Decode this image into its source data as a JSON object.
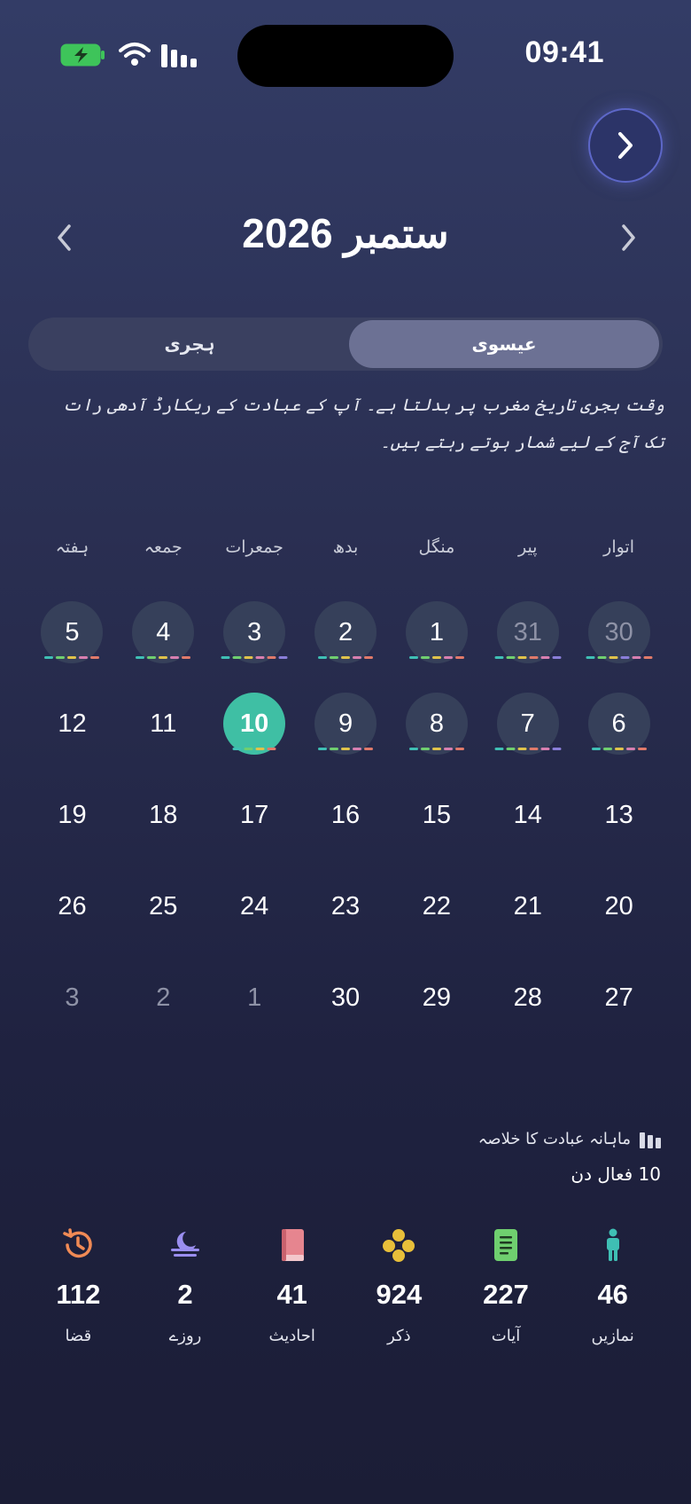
{
  "status_bar": {
    "time": "09:41"
  },
  "header": {
    "month_title": "ستمبر 2026"
  },
  "tabs": [
    {
      "label": "عیسوی",
      "active": true
    },
    {
      "label": "ہجری",
      "active": false
    }
  ],
  "note": "وقت ہجری تاریخ مغرب پر بدلتا ہے۔ آپ کے عبادت کے ریکارڈ آدھی رات تک آج کے لیے شمار ہوتے رہتے ہیں۔",
  "weekdays": [
    "اتوار",
    "پیر",
    "منگل",
    "بدھ",
    "جمعرات",
    "جمعہ",
    "ہفتہ"
  ],
  "days": [
    {
      "label": "30",
      "muted": true,
      "circle": true,
      "dots": [
        "#e07a6a",
        "#d77fb0",
        "#8a7ed8",
        "#e0c34a",
        "#6fcf6f",
        "#3fbfb4"
      ]
    },
    {
      "label": "31",
      "muted": true,
      "circle": true,
      "dots": [
        "#8a7ed8",
        "#d77fb0",
        "#e07a6a",
        "#e0c34a",
        "#6fcf6f",
        "#3fbfb4"
      ]
    },
    {
      "label": "1",
      "circle": true,
      "dots": [
        "#e07a6a",
        "#d77fb0",
        "#e0c34a",
        "#6fcf6f",
        "#3fbfb4"
      ]
    },
    {
      "label": "2",
      "circle": true,
      "dots": [
        "#e07a6a",
        "#d77fb0",
        "#e0c34a",
        "#6fcf6f",
        "#3fbfb4"
      ]
    },
    {
      "label": "3",
      "circle": true,
      "dots": [
        "#8a7ed8",
        "#e07a6a",
        "#d77fb0",
        "#e0c34a",
        "#6fcf6f",
        "#3fbfb4"
      ]
    },
    {
      "label": "4",
      "circle": true,
      "dots": [
        "#e07a6a",
        "#d77fb0",
        "#e0c34a",
        "#6fcf6f",
        "#3fbfb4"
      ]
    },
    {
      "label": "5",
      "circle": true,
      "dots": [
        "#e07a6a",
        "#d77fb0",
        "#e0c34a",
        "#6fcf6f",
        "#3fbfb4"
      ]
    },
    {
      "label": "6",
      "circle": true,
      "dots": [
        "#e07a6a",
        "#d77fb0",
        "#e0c34a",
        "#6fcf6f",
        "#3fbfb4"
      ]
    },
    {
      "label": "7",
      "circle": true,
      "dots": [
        "#8a7ed8",
        "#d77fb0",
        "#e07a6a",
        "#e0c34a",
        "#6fcf6f",
        "#3fbfb4"
      ]
    },
    {
      "label": "8",
      "circle": true,
      "dots": [
        "#e07a6a",
        "#d77fb0",
        "#e0c34a",
        "#6fcf6f",
        "#3fbfb4"
      ]
    },
    {
      "label": "9",
      "circle": true,
      "dots": [
        "#e07a6a",
        "#d77fb0",
        "#e0c34a",
        "#6fcf6f",
        "#3fbfb4"
      ]
    },
    {
      "label": "10",
      "today": true,
      "dots": [
        "#e07a6a",
        "#e0c34a",
        "#6fcf6f",
        "#3fbfb4"
      ]
    },
    {
      "label": "11"
    },
    {
      "label": "12"
    },
    {
      "label": "13"
    },
    {
      "label": "14"
    },
    {
      "label": "15"
    },
    {
      "label": "16"
    },
    {
      "label": "17"
    },
    {
      "label": "18"
    },
    {
      "label": "19"
    },
    {
      "label": "20"
    },
    {
      "label": "21"
    },
    {
      "label": "22"
    },
    {
      "label": "23"
    },
    {
      "label": "24"
    },
    {
      "label": "25"
    },
    {
      "label": "26"
    },
    {
      "label": "27"
    },
    {
      "label": "28"
    },
    {
      "label": "29"
    },
    {
      "label": "30"
    },
    {
      "label": "1",
      "muted": true
    },
    {
      "label": "2",
      "muted": true
    },
    {
      "label": "3",
      "muted": true
    }
  ],
  "summary": {
    "title": "ماہانہ عبادت کا خلاصہ",
    "active_days": "10 فعال دن",
    "icon": "bar-chart-icon"
  },
  "stats": [
    {
      "icon": "person-icon",
      "color": "#3fbfb4",
      "value": "46",
      "label": "نمازیں"
    },
    {
      "icon": "book-icon",
      "color": "#6fcf6f",
      "value": "227",
      "label": "آیات"
    },
    {
      "icon": "dots-icon",
      "color": "#e8bf3a",
      "value": "924",
      "label": "ذکر"
    },
    {
      "icon": "hadith-book-icon",
      "color": "#e6858f",
      "value": "41",
      "label": "احادیث"
    },
    {
      "icon": "moon-icon",
      "color": "#9a8ef0",
      "value": "2",
      "label": "روزے"
    },
    {
      "icon": "history-icon",
      "color": "#f08a55",
      "value": "112",
      "label": "قضا"
    }
  ]
}
